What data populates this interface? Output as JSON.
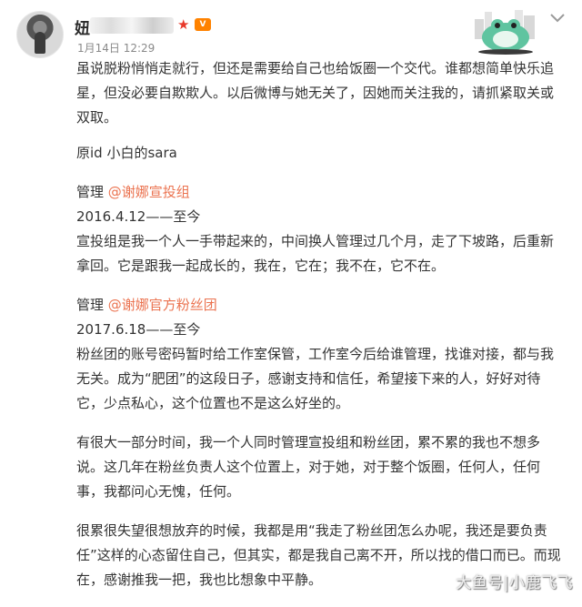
{
  "post": {
    "author": {
      "name_visible": "妞",
      "time": "1月14日 12:29"
    },
    "paragraphs": {
      "p1": "虽说脱粉悄悄走就行，但还是需要给自己也给饭圈一个交代。谁都想简单快乐追星，但没必要自欺欺人。以后微博与她无关了，因她而关注我的，请抓紧取关或双取。",
      "p2": "原id  小白的sara",
      "sec1_label": "管理 ",
      "sec1_link": "@谢娜宣投组",
      "sec1_date": "2016.4.12——至今",
      "sec1_text": "宣投组是我一个人一手带起来的，中间换人管理过几个月，走了下坡路，后重新拿回。它是跟我一起成长的，我在，它在；我不在，它不在。",
      "sec2_label": "管理 ",
      "sec2_link": "@谢娜官方粉丝团",
      "sec2_date": "2017.6.18——至今",
      "sec2_text": "粉丝团的账号密码暂时给工作室保管，工作室今后给谁管理，找谁对接，都与我无关。成为“肥团”的这段日子，感谢支持和信任，希望接下来的人，好好对待它，少点私心，这个位置也不是这么好坐的。",
      "p5": "有很大一部分时间，我一个人同时管理宣投组和粉丝团，累不累的我也不想多说。这几年在粉丝负责人这个位置上，对于她，对于整个饭圈，任何人，任何事，我都问心无愧，任何。",
      "p6": "很累很失望很想放弃的时候，我都是用“我走了粉丝团怎么办呢，我还是要负责任”这样的心态留住自己，但其实，都是我自己离不开，所以找的借口而已。而现在，感谢推我一把，我也比想象中平静。"
    }
  },
  "watermark": "大鱼号|小鹿飞飞",
  "icons": {
    "star": "★",
    "vip": "V"
  },
  "colors": {
    "link": "#eb7350",
    "time": "#8a8a8a"
  }
}
